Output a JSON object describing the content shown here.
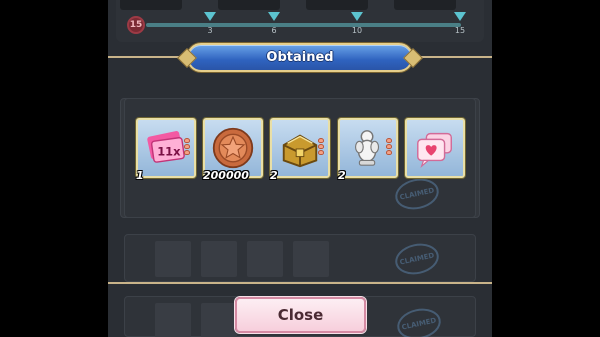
{
  "progress": {
    "current": "15",
    "markers": [
      "3",
      "6",
      "10",
      "15"
    ]
  },
  "dialog": {
    "title": "Obtained",
    "close_label": "Close"
  },
  "rewards": [
    {
      "name": "summon-ticket-11x",
      "art_label": "11x",
      "count": "1",
      "rarity": 3
    },
    {
      "name": "bronze-coin",
      "count": "200000",
      "rarity": 0
    },
    {
      "name": "gold-treasure-chest",
      "count": "2",
      "rarity": 3
    },
    {
      "name": "white-figure",
      "count": "2",
      "rarity": 3
    },
    {
      "name": "love-message",
      "count": "",
      "rarity": 0
    }
  ],
  "background": {
    "stamp_label": "CLAIMED"
  },
  "colors": {
    "banner_blue": "#2f63bf",
    "banner_gold": "#e6cf8c",
    "close_pink": "#f7cfdc",
    "divider_gold": "#c9b48a"
  }
}
